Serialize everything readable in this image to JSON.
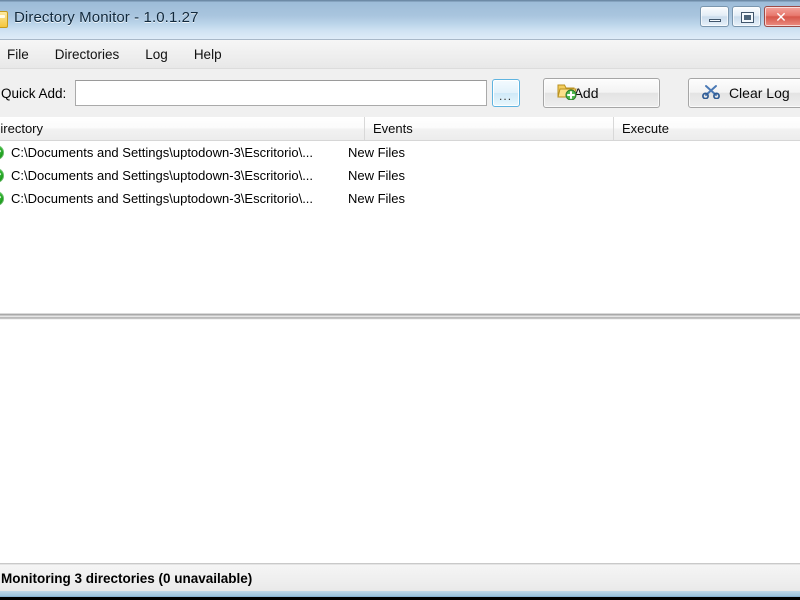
{
  "window": {
    "title": "Directory Monitor - 1.0.1.27",
    "icon": "folder-icon",
    "controls": {
      "minimize": "minimize-icon",
      "maximize": "maximize-icon",
      "close": "✕"
    }
  },
  "menu": {
    "items": [
      {
        "label": "File"
      },
      {
        "label": "Directories"
      },
      {
        "label": "Log"
      },
      {
        "label": "Help"
      }
    ]
  },
  "toolbar": {
    "quick_add_label": "Quick Add:",
    "quick_add_value": "",
    "quick_add_placeholder": "",
    "browse_label": "...",
    "add_label": "Add",
    "add_icon": "folder-add-icon",
    "clear_log_label": "Clear Log",
    "clear_log_icon": "scissors-icon"
  },
  "list": {
    "columns": [
      {
        "label": "Directory"
      },
      {
        "label": "Events"
      },
      {
        "label": "Execute"
      }
    ],
    "rows": [
      {
        "status": "active-icon",
        "directory": "C:\\Documents and Settings\\uptodown-3\\Escritorio\\...",
        "events": "New Files",
        "execute": ""
      },
      {
        "status": "active-icon",
        "directory": "C:\\Documents and Settings\\uptodown-3\\Escritorio\\...",
        "events": "New Files",
        "execute": ""
      },
      {
        "status": "active-icon",
        "directory": "C:\\Documents and Settings\\uptodown-3\\Escritorio\\...",
        "events": "New Files",
        "execute": ""
      }
    ]
  },
  "log": {
    "content": ""
  },
  "statusbar": {
    "text": "Monitoring 3 directories (0 unavailable)"
  },
  "colors": {
    "title_bar_top": "#9dbcd8",
    "title_bar_bottom": "#dfecf8",
    "status_active": "#36b636",
    "close_button": "#d6564a",
    "focus_border": "#5fb4e0",
    "window_border": "#8ab4d4"
  }
}
